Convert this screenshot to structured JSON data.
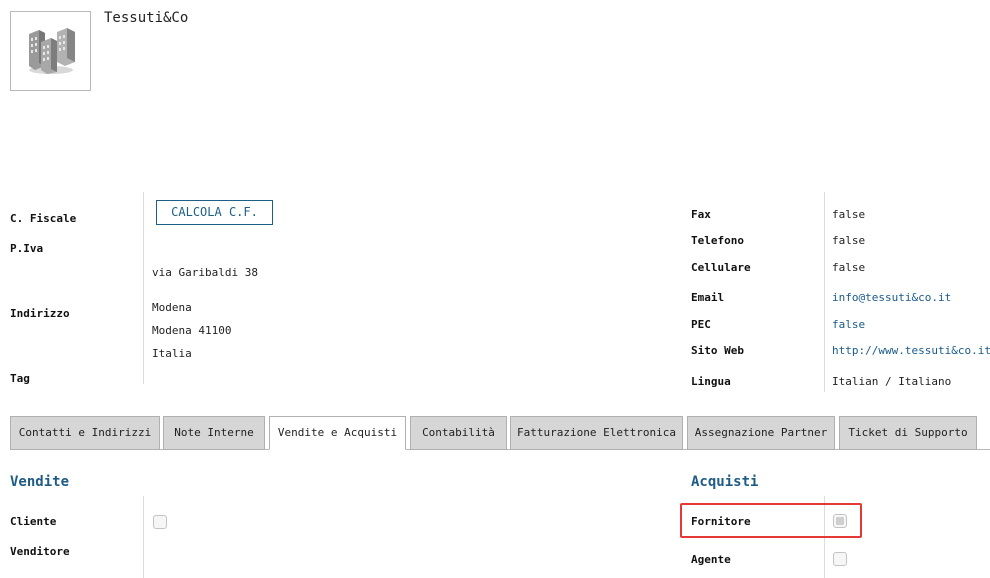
{
  "company": {
    "name": "Tessuti&Co",
    "avatar_icon": "buildings-icon"
  },
  "left_fields": {
    "codice_fiscale_label": "C. Fiscale",
    "calc_button": "CALCOLA C.F.",
    "piva_label": "P.Iva",
    "indirizzo_label": "Indirizzo",
    "street": "via Garibaldi 38",
    "city": "Modena",
    "zip_city": "Modena 41100",
    "country": "Italia",
    "tag_label": "Tag"
  },
  "right_fields": {
    "fax_label": "Fax",
    "fax_value": "false",
    "telefono_label": "Telefono",
    "telefono_value": "false",
    "cellulare_label": "Cellulare",
    "cellulare_value": "false",
    "email_label": "Email",
    "email_value": "info@tessuti&co.it",
    "pec_label": "PEC",
    "pec_value": "false",
    "sito_label": "Sito Web",
    "sito_value": "http://www.tessuti&co.it",
    "lingua_label": "Lingua",
    "lingua_value": "Italian / Italiano"
  },
  "tabs": [
    {
      "label": "Contatti e Indirizzi"
    },
    {
      "label": "Note Interne"
    },
    {
      "label": "Vendite e Acquisti",
      "active": true
    },
    {
      "label": "Contabilità"
    },
    {
      "label": "Fatturazione Elettronica"
    },
    {
      "label": "Assegnazione Partner"
    },
    {
      "label": "Ticket di Supporto"
    }
  ],
  "vendite": {
    "title": "Vendite",
    "cliente_label": "Cliente",
    "venditore_label": "Venditore"
  },
  "acquisti": {
    "title": "Acquisti",
    "fornitore_label": "Fornitore",
    "agente_label": "Agente"
  },
  "colors": {
    "accent": "#1e5b85",
    "link": "#1a5a8a",
    "highlight": "#e53935",
    "tab_bg": "#d6d6d6"
  }
}
